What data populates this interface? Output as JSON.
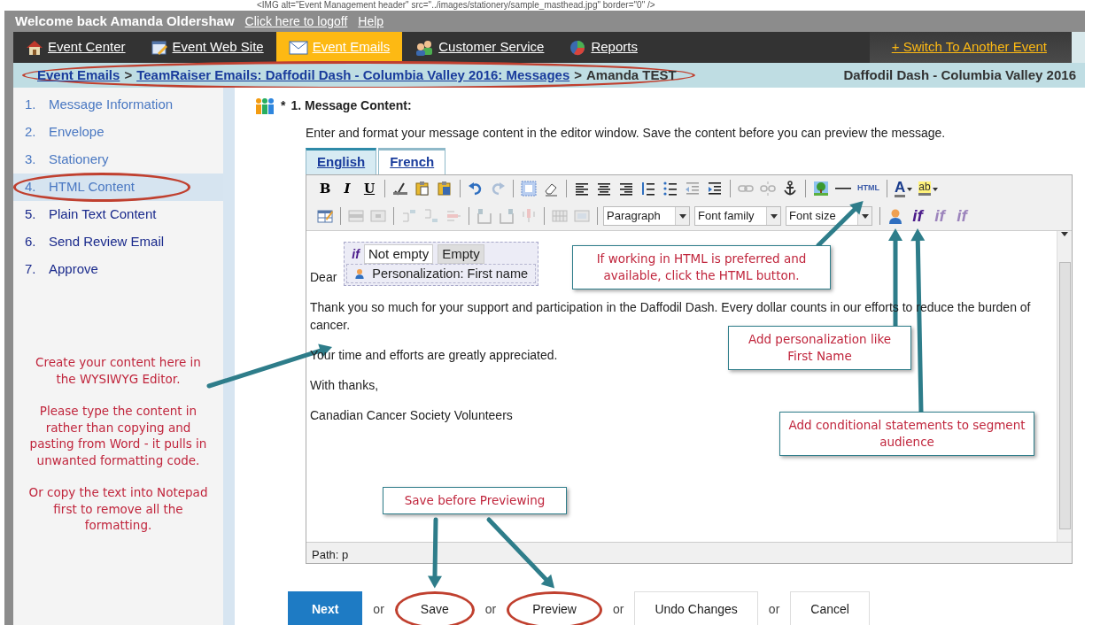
{
  "masthead_code": "<IMG alt=\"Event Management header\" src=\"../images/stationery/sample_masthead.jpg\" border=\"0\" />",
  "header": {
    "welcome": "Welcome back Amanda Oldershaw",
    "links": [
      "Click here to logoff",
      "Help"
    ]
  },
  "nav": {
    "items": [
      {
        "label": "Event Center",
        "kind": "house",
        "selected": false
      },
      {
        "label": "Event Web Site",
        "kind": "page",
        "selected": false
      },
      {
        "label": "Event Emails",
        "kind": "envelope",
        "selected": true
      },
      {
        "label": "Customer Service",
        "kind": "people",
        "selected": false
      },
      {
        "label": "Reports",
        "kind": "chart",
        "selected": false
      }
    ],
    "switch_link": "+ Switch To Another Event"
  },
  "breadcrumb": {
    "circled": true,
    "items": [
      {
        "text": "Event Emails",
        "kind": "link"
      },
      {
        "text": ">",
        "kind": "separator"
      },
      {
        "text": "TeamRaiser Emails: Daffodil Dash - Columbia Valley 2016: Messages",
        "kind": "link"
      },
      {
        "text": ">",
        "kind": "separator"
      },
      {
        "text": "Amanda TEST",
        "kind": "current"
      }
    ],
    "event_name": "Daffodil Dash - Columbia Valley 2016"
  },
  "sidebar": {
    "steps": [
      {
        "number": "1.",
        "label": "Message Information",
        "visited": true,
        "selected": false,
        "circled": false
      },
      {
        "number": "2.",
        "label": "Envelope",
        "visited": true,
        "selected": false,
        "circled": false
      },
      {
        "number": "3.",
        "label": "Stationery",
        "visited": true,
        "selected": false,
        "circled": false
      },
      {
        "number": "4.",
        "label": "HTML Content",
        "visited": true,
        "selected": true,
        "circled": true
      },
      {
        "number": "5.",
        "label": "Plain Text Content",
        "visited": false,
        "selected": false,
        "circled": false
      },
      {
        "number": "6.",
        "label": "Send Review Email",
        "visited": false,
        "selected": false,
        "circled": false
      },
      {
        "number": "7.",
        "label": "Approve",
        "visited": false,
        "selected": false,
        "circled": false
      }
    ],
    "note": [
      "Create your content here in the WYSIWYG Editor.",
      "Please type the content in rather than copying and pasting from Word - it pulls in unwanted formatting code.",
      "Or copy the text into Notepad first to remove all the formatting."
    ]
  },
  "section": {
    "required_mark": "*",
    "title": "1. Message Content:",
    "description": "Enter and format your message content in the editor window. Save the content before you can preview the message."
  },
  "language_tabs": [
    {
      "label": "English",
      "selected": true
    },
    {
      "label": "French",
      "selected": false
    }
  ],
  "editor": {
    "toolbar_rows": [
      [
        {
          "kind": "bold",
          "label": "B",
          "disabled": false
        },
        {
          "kind": "italic",
          "label": "I",
          "disabled": false
        },
        {
          "kind": "underline",
          "label": "U",
          "disabled": false
        },
        {
          "kind": "separator"
        },
        {
          "kind": "spellcheck",
          "disabled": false
        },
        {
          "kind": "pastetext",
          "disabled": false
        },
        {
          "kind": "pasteword",
          "disabled": false
        },
        {
          "kind": "separator"
        },
        {
          "kind": "undo",
          "disabled": false
        },
        {
          "kind": "redo",
          "disabled": true
        },
        {
          "kind": "separator"
        },
        {
          "kind": "selectall",
          "disabled": false
        },
        {
          "kind": "cleanup",
          "disabled": false
        },
        {
          "kind": "separator"
        },
        {
          "kind": "alignleft",
          "disabled": false
        },
        {
          "kind": "aligncenter",
          "disabled": false
        },
        {
          "kind": "alignright",
          "disabled": false
        },
        {
          "kind": "numbered",
          "disabled": false
        },
        {
          "kind": "bulleted",
          "disabled": false
        },
        {
          "kind": "outdent",
          "disabled": true
        },
        {
          "kind": "indent",
          "disabled": false
        },
        {
          "kind": "separator"
        },
        {
          "kind": "link",
          "disabled": true
        },
        {
          "kind": "unlink",
          "disabled": true
        },
        {
          "kind": "anchor",
          "disabled": false
        },
        {
          "kind": "separator"
        },
        {
          "kind": "image",
          "disabled": false
        },
        {
          "kind": "rule",
          "disabled": false
        },
        {
          "kind": "html",
          "label": "HTML",
          "disabled": false
        },
        {
          "kind": "separator"
        },
        {
          "kind": "forecolor",
          "label": "A",
          "disabled": false
        },
        {
          "kind": "backcolor",
          "label": "ab",
          "disabled": false
        }
      ],
      [
        {
          "kind": "table",
          "disabled": false
        },
        {
          "kind": "separator"
        },
        {
          "kind": "rowprops",
          "disabled": true
        },
        {
          "kind": "cellprops",
          "disabled": true
        },
        {
          "kind": "separator"
        },
        {
          "kind": "rowbefore",
          "disabled": true
        },
        {
          "kind": "rowafter",
          "disabled": true
        },
        {
          "kind": "rowdelete",
          "disabled": true
        },
        {
          "kind": "separator"
        },
        {
          "kind": "colbefore",
          "disabled": true
        },
        {
          "kind": "colafter",
          "disabled": true
        },
        {
          "kind": "coldelete",
          "disabled": true
        },
        {
          "kind": "separator"
        },
        {
          "kind": "split",
          "disabled": true
        },
        {
          "kind": "merge",
          "disabled": true
        },
        {
          "kind": "separator"
        },
        {
          "kind": "select",
          "value": "Paragraph"
        },
        {
          "kind": "select",
          "value": "Font family"
        },
        {
          "kind": "select",
          "value": "Font size"
        },
        {
          "kind": "separator"
        },
        {
          "kind": "personalize",
          "disabled": false
        },
        {
          "kind": "condition",
          "label": "if",
          "disabled": false
        },
        {
          "kind": "conditionedit",
          "label": "if",
          "disabled": true
        },
        {
          "kind": "conditionelse",
          "label": "if",
          "disabled": true
        }
      ]
    ],
    "personalization": {
      "condition_label": "if",
      "tabs": [
        {
          "label": "Not empty",
          "selected": true
        },
        {
          "label": "Empty",
          "selected": false
        }
      ],
      "field": "Personalization: First name"
    },
    "greeting": "Dear",
    "paragraphs": [
      "Thank you so much for your support and participation in the Daffodil Dash. Every dollar counts in our efforts to reduce the burden of cancer.",
      "Your time and efforts are greatly appreciated.",
      "With thanks,",
      "Canadian Cancer Society Volunteers"
    ],
    "path": "Path: p"
  },
  "annotations": [
    "If working in HTML is preferred and available, click the HTML button.",
    "Add personalization like First Name",
    "Add conditional statements to segment audience",
    "Save before Previewing"
  ],
  "actions": [
    {
      "kind": "button",
      "label": "Next",
      "primary": true,
      "circled": false
    },
    {
      "kind": "text",
      "label": "or"
    },
    {
      "kind": "button",
      "label": "Save",
      "primary": false,
      "circled": true
    },
    {
      "kind": "text",
      "label": "or"
    },
    {
      "kind": "button",
      "label": "Preview",
      "primary": false,
      "circled": true
    },
    {
      "kind": "text",
      "label": "or"
    },
    {
      "kind": "button",
      "label": "Undo Changes",
      "primary": false,
      "circled": false
    },
    {
      "kind": "text",
      "label": "or"
    },
    {
      "kind": "button",
      "label": "Cancel",
      "primary": false,
      "circled": false
    }
  ]
}
